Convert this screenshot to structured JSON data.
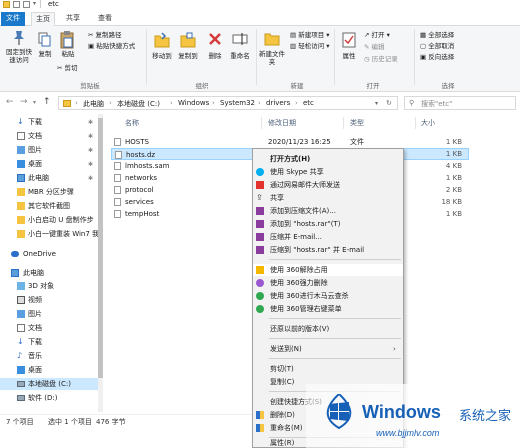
{
  "window": {
    "title": "etc"
  },
  "ribbon_tabs": [
    "文件",
    "主页",
    "共享",
    "查看"
  ],
  "ribbon": {
    "pin": "固定到快速访问",
    "copy": "复制",
    "paste": "粘贴",
    "copy_path": "复制路径",
    "paste_shortcut": "粘贴快捷方式",
    "cut": "剪切",
    "group_clipboard": "剪贴板",
    "move_to": "移动到",
    "copy_to": "复制到",
    "delete": "删除",
    "rename": "重命名",
    "group_organize": "组织",
    "new_folder": "新建文件夹",
    "new_item": "新建项目 ▾",
    "easy_access": "轻松访问 ▾",
    "group_new": "新建",
    "properties": "属性",
    "open": "打开 ▾",
    "edit": "编辑",
    "history": "历史记录",
    "group_open": "打开",
    "select_all": "全部选择",
    "select_none": "全部取消",
    "invert_selection": "反向选择",
    "group_select": "选择"
  },
  "address": {
    "path": [
      "此电脑",
      "本地磁盘 (C:)",
      "Windows",
      "System32",
      "drivers",
      "etc"
    ],
    "search_placeholder": "搜索\"etc\""
  },
  "nav": {
    "items": [
      {
        "label": "下载",
        "icon": "download-icon",
        "pinned": true
      },
      {
        "label": "文档",
        "icon": "document-icon",
        "pinned": true
      },
      {
        "label": "图片",
        "icon": "picture-icon",
        "pinned": true
      },
      {
        "label": "桌面",
        "icon": "desktop-icon",
        "pinned": true
      },
      {
        "label": "此电脑",
        "icon": "pc-icon",
        "pinned": true
      },
      {
        "label": "MBR 分区步骤",
        "icon": "folder-icon"
      },
      {
        "label": "其它软件截图",
        "icon": "folder-icon"
      },
      {
        "label": "小白启动 U 盘制作步",
        "icon": "folder-icon"
      },
      {
        "label": "小白一键重装 Win7 我",
        "icon": "folder-icon"
      },
      {
        "label": "OneDrive",
        "icon": "onedrive-icon"
      },
      {
        "label": "此电脑",
        "icon": "pc-icon"
      },
      {
        "label": "3D 对象",
        "icon": "3d-objects-icon"
      },
      {
        "label": "视频",
        "icon": "video-icon"
      },
      {
        "label": "图片",
        "icon": "picture-icon"
      },
      {
        "label": "文档",
        "icon": "document-icon"
      },
      {
        "label": "下载",
        "icon": "download-icon"
      },
      {
        "label": "音乐",
        "icon": "music-icon"
      },
      {
        "label": "桌面",
        "icon": "desktop-icon"
      },
      {
        "label": "本地磁盘 (C:)",
        "icon": "drive-icon"
      },
      {
        "label": "软件 (D:)",
        "icon": "drive-icon"
      }
    ]
  },
  "columns": {
    "name": "名称",
    "date": "修改日期",
    "type": "类型",
    "size": "大小"
  },
  "files": [
    {
      "name": "HOSTS",
      "date": "2020/11/23 16:25",
      "type": "文件",
      "size": "1 KB"
    },
    {
      "name": "hosts.dz",
      "date": "",
      "type": "",
      "size": "1 KB"
    },
    {
      "name": "lmhosts.sam",
      "date": "",
      "type": "",
      "size": "4 KB"
    },
    {
      "name": "networks",
      "date": "",
      "type": "",
      "size": "1 KB"
    },
    {
      "name": "protocol",
      "date": "",
      "type": "",
      "size": "2 KB"
    },
    {
      "name": "services",
      "date": "",
      "type": "",
      "size": "18 KB"
    },
    {
      "name": "tempHost",
      "date": "",
      "type": "",
      "size": "1 KB"
    }
  ],
  "status": {
    "count": "7 个项目",
    "selected": "选中 1 个项目",
    "size": "476 字节"
  },
  "context_menu": [
    {
      "label": "打开方式(H)",
      "bold": true
    },
    {
      "label": "使用 Skype 共享",
      "icon": "skype-icon"
    },
    {
      "label": "通过网易邮件大师发送",
      "icon": "netease-mail-icon"
    },
    {
      "label": "共享",
      "icon": "share-icon"
    },
    {
      "label": "添加到压缩文件(A)...",
      "icon": "winrar-icon"
    },
    {
      "label": "添加到 \"hosts.rar\"(T)",
      "icon": "winrar-icon"
    },
    {
      "label": "压缩并 E-mail...",
      "icon": "winrar-icon"
    },
    {
      "label": "压缩到 \"hosts.rar\" 并 E-mail",
      "icon": "winrar-icon"
    },
    {
      "label": "使用 360解除占用",
      "icon": "360-unlock-icon"
    },
    {
      "label": "使用 360强力删除",
      "icon": "360-delete-icon"
    },
    {
      "label": "使用 360进行木马云查杀",
      "icon": "360-scan-icon"
    },
    {
      "label": "使用 360管理右键菜单",
      "icon": "360-menu-icon"
    },
    {
      "label": "还原以前的版本(V)"
    },
    {
      "label": "发送到(N)",
      "submenu": "›"
    },
    {
      "label": "剪切(T)"
    },
    {
      "label": "复制(C)"
    },
    {
      "label": "创建快捷方式(S)"
    },
    {
      "label": "删除(D)",
      "icon": "shield-icon"
    },
    {
      "label": "重命名(M)",
      "icon": "shield-icon"
    },
    {
      "label": "属性(R)"
    }
  ],
  "watermark": {
    "title": "Windows",
    "subtitle": "系统之家",
    "url": "www.bjjmlv.com"
  },
  "colors": {
    "accent": "#1979ca",
    "selection": "#cce8ff",
    "folder": "#f5c542"
  }
}
